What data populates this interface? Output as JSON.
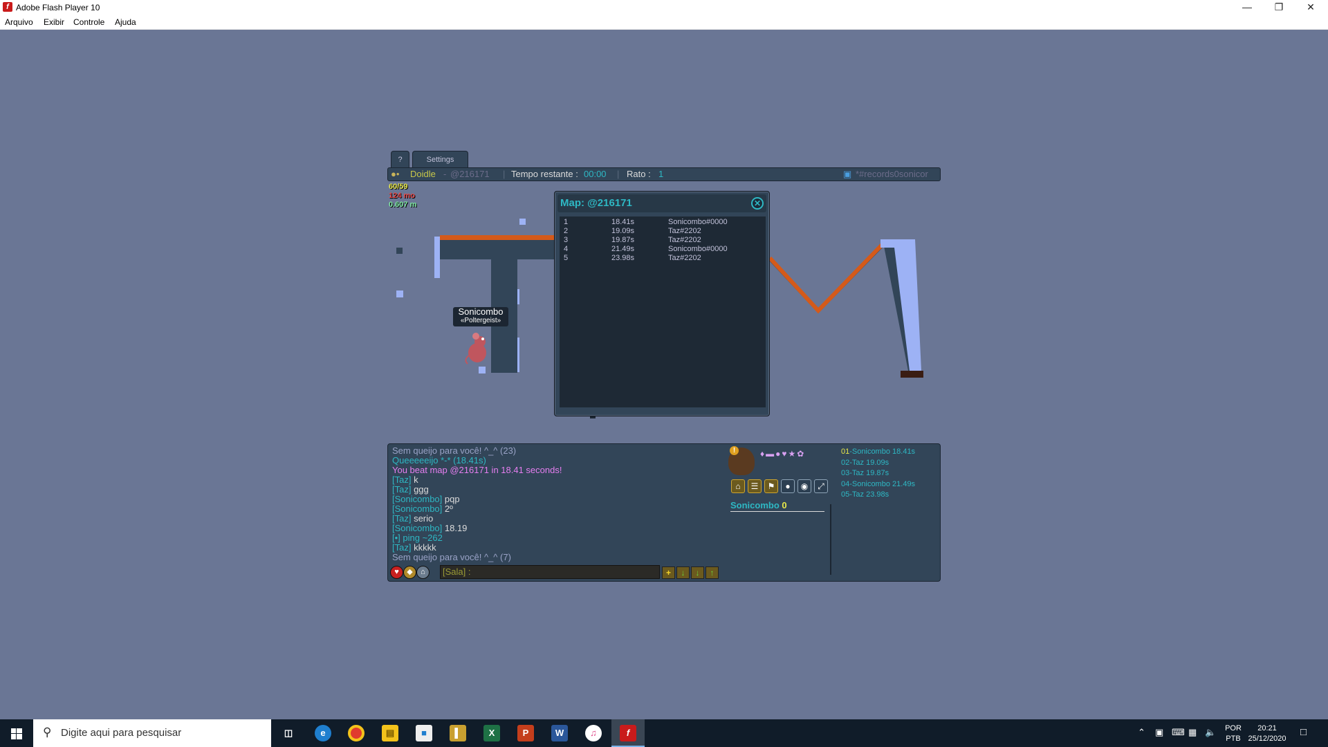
{
  "window": {
    "title": "Adobe Flash Player 10",
    "app_icon": "flash-icon",
    "controls": [
      "minimize-icon",
      "restore-icon",
      "close-icon"
    ],
    "menu": [
      "Arquivo",
      "Exibir",
      "Controle",
      "Ajuda"
    ]
  },
  "game": {
    "tabs": {
      "help": "?",
      "settings": "Settings"
    },
    "hud": {
      "map_author": "Doidle",
      "map_code": "@216171",
      "time_label": "Tempo restante :",
      "time_value": "00:00",
      "mice_label": "Rato :",
      "mice_value": "1",
      "room": "*#records0sonicor"
    },
    "stats": {
      "fps": "60/59",
      "memory": "124 mo",
      "distance": "0.607 m"
    },
    "player": {
      "name": "Sonicombo",
      "title": "«Poltergeist»"
    },
    "records_popup": {
      "title": "Map: @216171",
      "rows": [
        {
          "rank": "1",
          "time": "18.41s",
          "player": "Sonicombo#0000"
        },
        {
          "rank": "2",
          "time": "19.09s",
          "player": "Taz#2202"
        },
        {
          "rank": "3",
          "time": "19.87s",
          "player": "Taz#2202"
        },
        {
          "rank": "4",
          "time": "21.49s",
          "player": "Sonicombo#0000"
        },
        {
          "rank": "5",
          "time": "23.98s",
          "player": "Taz#2202"
        }
      ]
    },
    "chat": {
      "lines": [
        {
          "name": "",
          "text": "Sem queijo para você! ^_^ (23)",
          "color": "#9aa3c7"
        },
        {
          "name": "",
          "text": "Queeeeeijo *-* (18.41s)",
          "color": "#2eb8c4"
        },
        {
          "name": "",
          "text": "You beat map @216171 in 18.41 seconds!",
          "color": "#e67ef0"
        },
        {
          "name": "[Taz]",
          "text": " k",
          "color": "#dcdcdc"
        },
        {
          "name": "[Taz]",
          "text": " ggg",
          "color": "#dcdcdc"
        },
        {
          "name": "[Sonicombo]",
          "text": " pqp",
          "color": "#dcdcdc"
        },
        {
          "name": "[Sonicombo]",
          "text": " 2º",
          "color": "#dcdcdc"
        },
        {
          "name": "[Taz]",
          "text": " serio",
          "color": "#dcdcdc"
        },
        {
          "name": "[Sonicombo]",
          "text": " 18.19",
          "color": "#dcdcdc"
        },
        {
          "name": "[•]",
          "text": " ping ~262",
          "color": "#2eb8c4"
        },
        {
          "name": "[Taz]",
          "text": " kkkkk",
          "color": "#dcdcdc"
        },
        {
          "name": "",
          "text": "Sem queijo para você! ^_^ (7)",
          "color": "#9aa3c7"
        }
      ],
      "input_prefix": "[Sala] :"
    },
    "player_panel": {
      "name": "Sonicombo",
      "score": "0"
    },
    "ranking": [
      {
        "pos": "01",
        "name": "Sonicombo",
        "time": "18.41s"
      },
      {
        "pos": "02",
        "name": "Taz",
        "time": "19.09s"
      },
      {
        "pos": "03",
        "name": "Taz",
        "time": "19.87s"
      },
      {
        "pos": "04",
        "name": "Sonicombo",
        "time": "21.49s"
      },
      {
        "pos": "05",
        "name": "Taz",
        "time": "23.98s"
      }
    ]
  },
  "taskbar": {
    "search_placeholder": "Digite aqui para pesquisar",
    "apps": [
      "task-view-icon",
      "edge-icon",
      "chrome-icon",
      "file-explorer-icon",
      "store-icon",
      "library-icon",
      "excel-icon",
      "powerpoint-icon",
      "word-icon",
      "itunes-icon",
      "flash-player-icon"
    ],
    "lang_top": "POR",
    "lang_bottom": "PTB",
    "time": "20:21",
    "date": "25/12/2020"
  },
  "colors": {
    "background": "#6a7695",
    "panel": "#324558",
    "accent": "#2eb8c4",
    "highlight": "#009ba6",
    "ground_line": "#d45a1a"
  }
}
